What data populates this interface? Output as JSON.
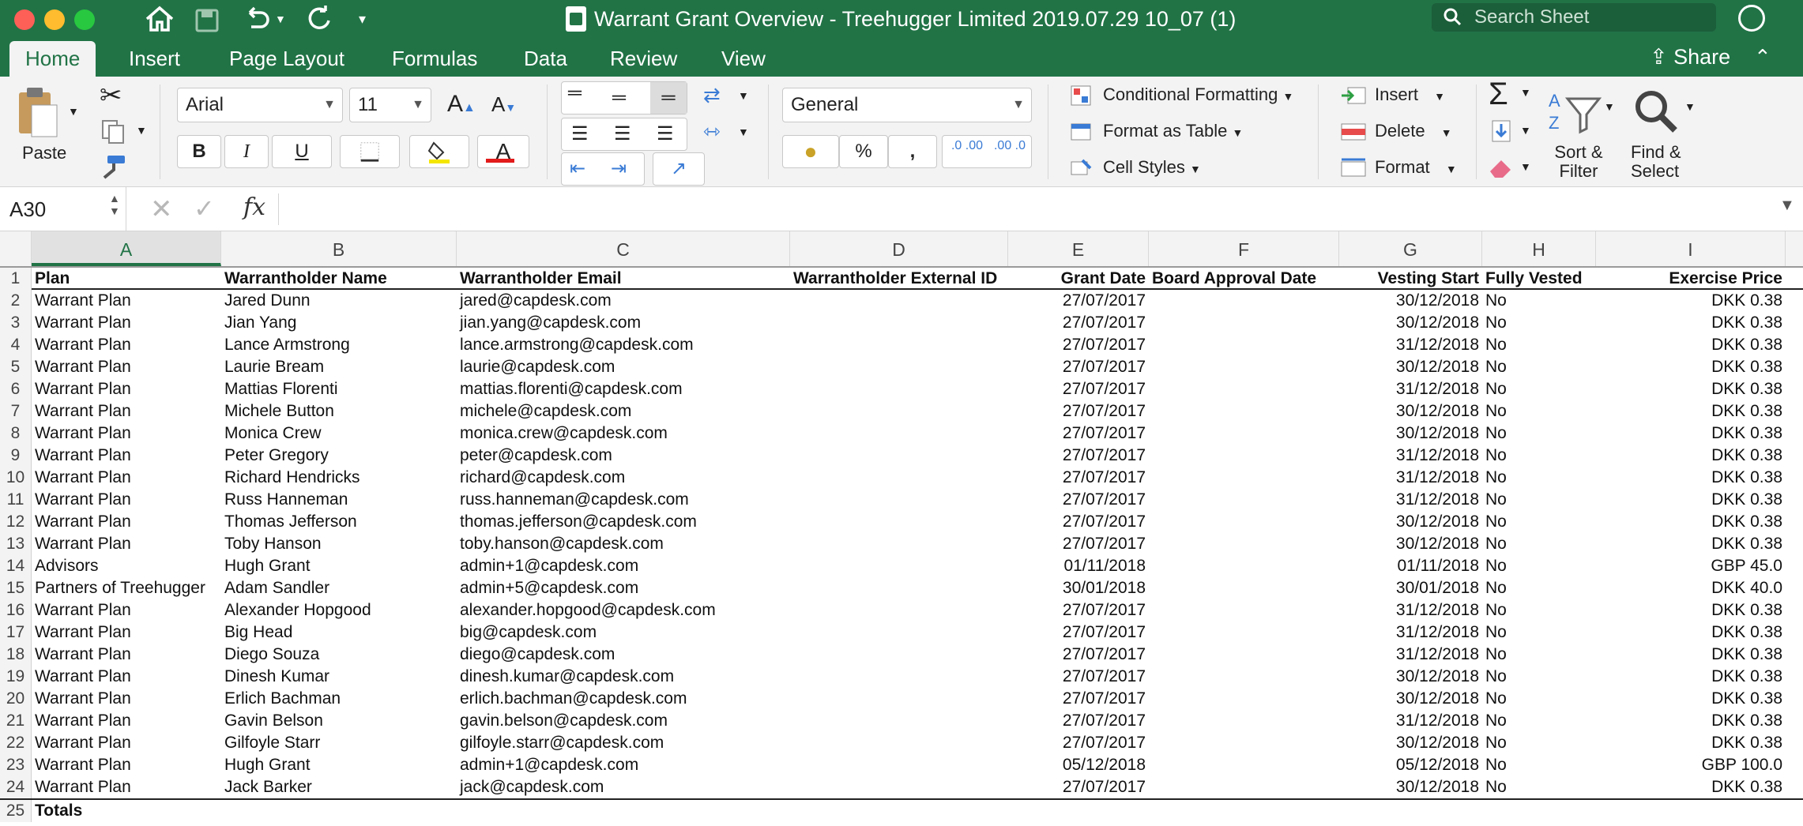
{
  "window": {
    "title": "Warrant Grant Overview - Treehugger Limited 2019.07.29 10_07 (1)",
    "search_placeholder": "Search Sheet"
  },
  "tabs": [
    "Home",
    "Insert",
    "Page Layout",
    "Formulas",
    "Data",
    "Review",
    "View"
  ],
  "share_label": "Share",
  "ribbon": {
    "paste": "Paste",
    "font_name": "Arial",
    "font_size": "11",
    "bold": "B",
    "italic": "I",
    "underline": "U",
    "number_format": "General",
    "percent": "%",
    "comma": ",",
    "inc_decimal": ".0 .00",
    "dec_decimal": ".00 .0",
    "conditional_formatting": "Conditional Formatting",
    "format_as_table": "Format as Table",
    "cell_styles": "Cell Styles",
    "insert": "Insert",
    "delete": "Delete",
    "format": "Format",
    "sort_filter_1": "Sort &",
    "sort_filter_2": "Filter",
    "find_select_1": "Find &",
    "find_select_2": "Select"
  },
  "formula_bar": {
    "name_box": "A30",
    "fx": "fx",
    "value": ""
  },
  "columns": [
    "A",
    "B",
    "C",
    "D",
    "E",
    "F",
    "G",
    "H",
    "I"
  ],
  "headers": [
    "Plan",
    "Warrantholder Name",
    "Warrantholder Email",
    "Warrantholder External ID",
    "Grant Date",
    "Board Approval Date",
    "Vesting Start",
    "Fully Vested",
    "Exercise Price"
  ],
  "rows": [
    [
      "Warrant Plan",
      "Jared Dunn",
      "jared@capdesk.com",
      "",
      "27/07/2017",
      "",
      "30/12/2018",
      "No",
      "DKK 0.38"
    ],
    [
      "Warrant Plan",
      "Jian Yang",
      "jian.yang@capdesk.com",
      "",
      "27/07/2017",
      "",
      "30/12/2018",
      "No",
      "DKK 0.38"
    ],
    [
      "Warrant Plan",
      "Lance Armstrong",
      "lance.armstrong@capdesk.com",
      "",
      "27/07/2017",
      "",
      "31/12/2018",
      "No",
      "DKK 0.38"
    ],
    [
      "Warrant Plan",
      "Laurie Bream",
      "laurie@capdesk.com",
      "",
      "27/07/2017",
      "",
      "30/12/2018",
      "No",
      "DKK 0.38"
    ],
    [
      "Warrant Plan",
      "Mattias Florenti",
      "mattias.florenti@capdesk.com",
      "",
      "27/07/2017",
      "",
      "31/12/2018",
      "No",
      "DKK 0.38"
    ],
    [
      "Warrant Plan",
      "Michele Button",
      "michele@capdesk.com",
      "",
      "27/07/2017",
      "",
      "30/12/2018",
      "No",
      "DKK 0.38"
    ],
    [
      "Warrant Plan",
      "Monica Crew",
      "monica.crew@capdesk.com",
      "",
      "27/07/2017",
      "",
      "30/12/2018",
      "No",
      "DKK 0.38"
    ],
    [
      "Warrant Plan",
      "Peter Gregory",
      "peter@capdesk.com",
      "",
      "27/07/2017",
      "",
      "31/12/2018",
      "No",
      "DKK 0.38"
    ],
    [
      "Warrant Plan",
      "Richard Hendricks",
      "richard@capdesk.com",
      "",
      "27/07/2017",
      "",
      "31/12/2018",
      "No",
      "DKK 0.38"
    ],
    [
      "Warrant Plan",
      "Russ Hanneman",
      "russ.hanneman@capdesk.com",
      "",
      "27/07/2017",
      "",
      "31/12/2018",
      "No",
      "DKK 0.38"
    ],
    [
      "Warrant Plan",
      "Thomas Jefferson",
      "thomas.jefferson@capdesk.com",
      "",
      "27/07/2017",
      "",
      "30/12/2018",
      "No",
      "DKK 0.38"
    ],
    [
      "Warrant Plan",
      "Toby Hanson",
      "toby.hanson@capdesk.com",
      "",
      "27/07/2017",
      "",
      "30/12/2018",
      "No",
      "DKK 0.38"
    ],
    [
      "Advisors",
      "Hugh Grant",
      "admin+1@capdesk.com",
      "",
      "01/11/2018",
      "",
      "01/11/2018",
      "No",
      "GBP 45.0"
    ],
    [
      "Partners of Treehugger",
      "Adam Sandler",
      "admin+5@capdesk.com",
      "",
      "30/01/2018",
      "",
      "30/01/2018",
      "No",
      "DKK 40.0"
    ],
    [
      "Warrant Plan",
      "Alexander Hopgood",
      "alexander.hopgood@capdesk.com",
      "",
      "27/07/2017",
      "",
      "31/12/2018",
      "No",
      "DKK 0.38"
    ],
    [
      "Warrant Plan",
      "Big Head",
      "big@capdesk.com",
      "",
      "27/07/2017",
      "",
      "31/12/2018",
      "No",
      "DKK 0.38"
    ],
    [
      "Warrant Plan",
      "Diego Souza",
      "diego@capdesk.com",
      "",
      "27/07/2017",
      "",
      "31/12/2018",
      "No",
      "DKK 0.38"
    ],
    [
      "Warrant Plan",
      "Dinesh Kumar",
      "dinesh.kumar@capdesk.com",
      "",
      "27/07/2017",
      "",
      "30/12/2018",
      "No",
      "DKK 0.38"
    ],
    [
      "Warrant Plan",
      "Erlich Bachman",
      "erlich.bachman@capdesk.com",
      "",
      "27/07/2017",
      "",
      "30/12/2018",
      "No",
      "DKK 0.38"
    ],
    [
      "Warrant Plan",
      "Gavin Belson",
      "gavin.belson@capdesk.com",
      "",
      "27/07/2017",
      "",
      "31/12/2018",
      "No",
      "DKK 0.38"
    ],
    [
      "Warrant Plan",
      "Gilfoyle Starr",
      "gilfoyle.starr@capdesk.com",
      "",
      "27/07/2017",
      "",
      "30/12/2018",
      "No",
      "DKK 0.38"
    ],
    [
      "Warrant Plan",
      "Hugh Grant",
      "admin+1@capdesk.com",
      "",
      "05/12/2018",
      "",
      "05/12/2018",
      "No",
      "GBP 100.0"
    ],
    [
      "Warrant Plan",
      "Jack Barker",
      "jack@capdesk.com",
      "",
      "27/07/2017",
      "",
      "30/12/2018",
      "No",
      "DKK 0.38"
    ]
  ],
  "totals_label": "Totals",
  "colors": {
    "accent": "#217346"
  }
}
